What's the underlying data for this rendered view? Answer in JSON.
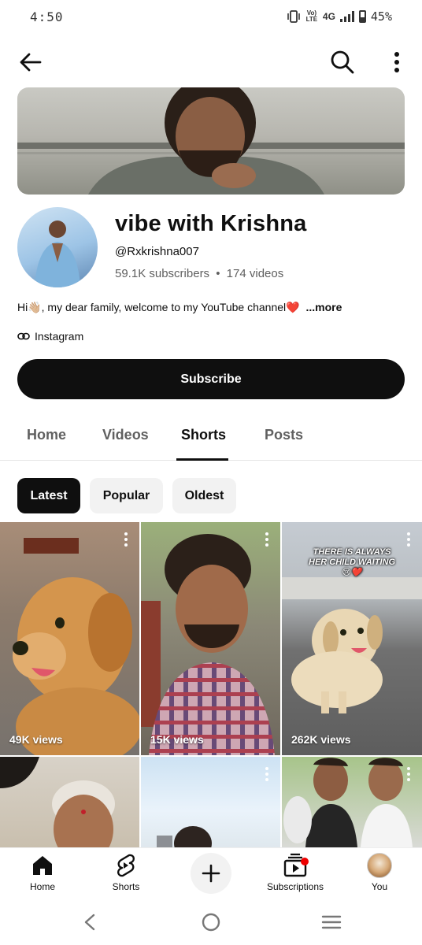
{
  "status": {
    "time": "4:50",
    "volte": "Vo) LTE",
    "network": "4G",
    "battery": "45%"
  },
  "channel": {
    "name": "vibe with Krishna",
    "handle": "@Rxkrishna007",
    "subscribers": "59.1K subscribers",
    "separator": "•",
    "videos": "174 videos",
    "description": "Hi👋🏼, my dear family, welcome to my YouTube channel❤️",
    "more": "...more",
    "link_label": "Instagram",
    "subscribe_label": "Subscribe"
  },
  "tabs": [
    "Home",
    "Videos",
    "Shorts",
    "Posts"
  ],
  "active_tab": "Shorts",
  "chips": [
    "Latest",
    "Popular",
    "Oldest"
  ],
  "active_chip": "Latest",
  "shorts": [
    {
      "views": "49K views",
      "caption": ""
    },
    {
      "views": "15K views",
      "caption": ""
    },
    {
      "views": "262K views",
      "caption": "THERE IS ALWAYS HER CHILD WAITING😢❤️"
    },
    {
      "views": "",
      "caption": ""
    },
    {
      "views": "",
      "caption": ""
    },
    {
      "views": "",
      "caption": ""
    }
  ],
  "bottom_nav": {
    "home": "Home",
    "shorts": "Shorts",
    "subscriptions": "Subscriptions",
    "you": "You"
  },
  "icons": {
    "back": "arrow-left-icon",
    "search": "search-icon",
    "more": "more-vert-icon",
    "link": "link-icon",
    "create": "plus-icon",
    "home": "home-icon",
    "shorts": "shorts-icon",
    "subscriptions": "subscriptions-icon"
  },
  "colors": {
    "primary": "#0f0f0f",
    "secondary_text": "#606060",
    "chip_bg": "#f2f2f2",
    "notification": "#ee0000"
  }
}
